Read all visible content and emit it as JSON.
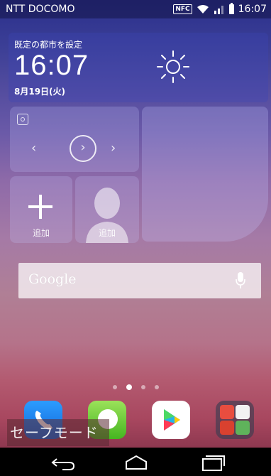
{
  "status_bar": {
    "carrier": "NTT DOCOMO",
    "nfc_label": "NFC",
    "time": "16:07",
    "icons": [
      "nfc-icon",
      "wifi-icon",
      "signal-icon",
      "battery-icon"
    ]
  },
  "clock_widget": {
    "city_label": "既定の都市を設定",
    "time": "16:07",
    "date": "8月19日(火)",
    "weather_icon": "sun-icon"
  },
  "music_widget": {
    "icons": [
      "disc-icon",
      "previous-icon",
      "play-icon",
      "next-icon"
    ],
    "prev_glyph": "‹",
    "play_glyph": "›",
    "next_glyph": "›"
  },
  "add_tile": {
    "label": "追加",
    "icon": "plus-icon"
  },
  "contact_tile": {
    "label": "追加",
    "icon": "person-icon"
  },
  "search": {
    "logo": "Google",
    "icon": "microphone-icon"
  },
  "page_indicator": {
    "pages": 4,
    "active": 2
  },
  "dock": [
    {
      "name": "phone-icon"
    },
    {
      "name": "messaging-icon"
    },
    {
      "name": "play-store-icon"
    },
    {
      "name": "google-apps-folder-icon"
    }
  ],
  "safe_mode_label": "セーフモード",
  "nav": [
    "back-icon",
    "home-icon",
    "recents-icon"
  ],
  "colors": {
    "wallpaper_top": "#2a2f8c",
    "wallpaper_bottom": "#a8475f"
  }
}
